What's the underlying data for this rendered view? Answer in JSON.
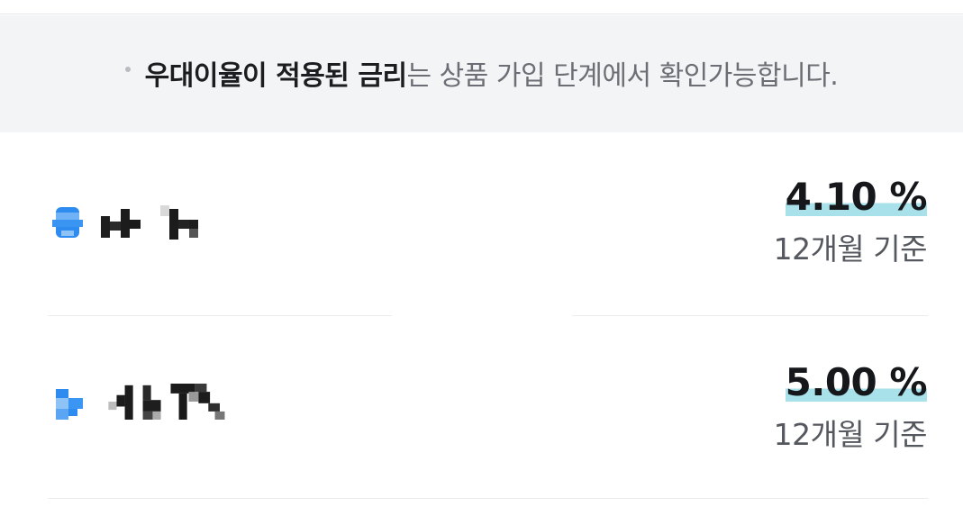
{
  "notice": {
    "emphasis": "우대이율이 적용된 금리",
    "rest": "는 상품 가입 단계에서 확인가능합니다."
  },
  "products": [
    {
      "rate": "4.10 %",
      "period": "12개월 기준"
    },
    {
      "rate": "5.00 %",
      "period": "12개월 기준"
    }
  ],
  "colors": {
    "notice_bg": "#f3f4f6",
    "rate_highlight": "#a9e1eb",
    "logo_blue": "#2e8cf0"
  }
}
